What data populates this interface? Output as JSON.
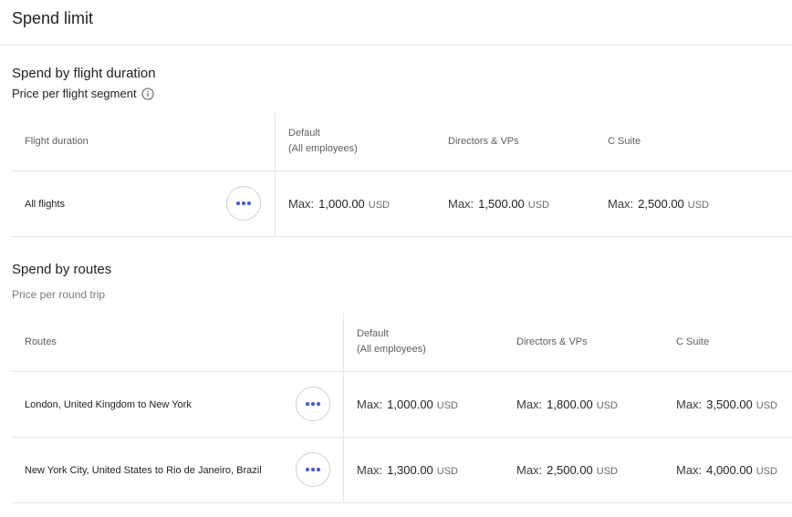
{
  "page": {
    "title": "Spend limit"
  },
  "flight_section": {
    "title": "Spend by flight duration",
    "subtitle": "Price per flight segment",
    "row_header": "Flight duration",
    "columns": [
      {
        "line1": "Default",
        "line2": "(All employees)"
      },
      {
        "line1": "Directors & VPs",
        "line2": ""
      },
      {
        "line1": "C Suite",
        "line2": ""
      }
    ],
    "rows": [
      {
        "label": "All flights",
        "cells": [
          {
            "prefix": "Max:",
            "amount": "1,000.00",
            "currency": "USD"
          },
          {
            "prefix": "Max:",
            "amount": "1,500.00",
            "currency": "USD"
          },
          {
            "prefix": "Max:",
            "amount": "2,500.00",
            "currency": "USD"
          }
        ]
      }
    ]
  },
  "routes_section": {
    "title": "Spend by routes",
    "subtitle": "Price per round trip",
    "row_header": "Routes",
    "columns": [
      {
        "line1": "Default",
        "line2": "(All employees)"
      },
      {
        "line1": "Directors & VPs",
        "line2": ""
      },
      {
        "line1": "C Suite",
        "line2": ""
      }
    ],
    "rows": [
      {
        "label": "London, United Kingdom to New York",
        "cells": [
          {
            "prefix": "Max:",
            "amount": "1,000.00",
            "currency": "USD"
          },
          {
            "prefix": "Max:",
            "amount": "1,800.00",
            "currency": "USD"
          },
          {
            "prefix": "Max:",
            "amount": "3,500.00",
            "currency": "USD"
          }
        ]
      },
      {
        "label": "New York City, United States to Rio de Janeiro, Brazil",
        "cells": [
          {
            "prefix": "Max:",
            "amount": "1,300.00",
            "currency": "USD"
          },
          {
            "prefix": "Max:",
            "amount": "2,500.00",
            "currency": "USD"
          },
          {
            "prefix": "Max:",
            "amount": "4,000.00",
            "currency": "USD"
          }
        ]
      }
    ]
  },
  "icons": {
    "info": "info-icon",
    "more": "more-horizontal-icon"
  },
  "colors": {
    "accent": "#4a5bd1",
    "border": "#e6e6e6"
  }
}
